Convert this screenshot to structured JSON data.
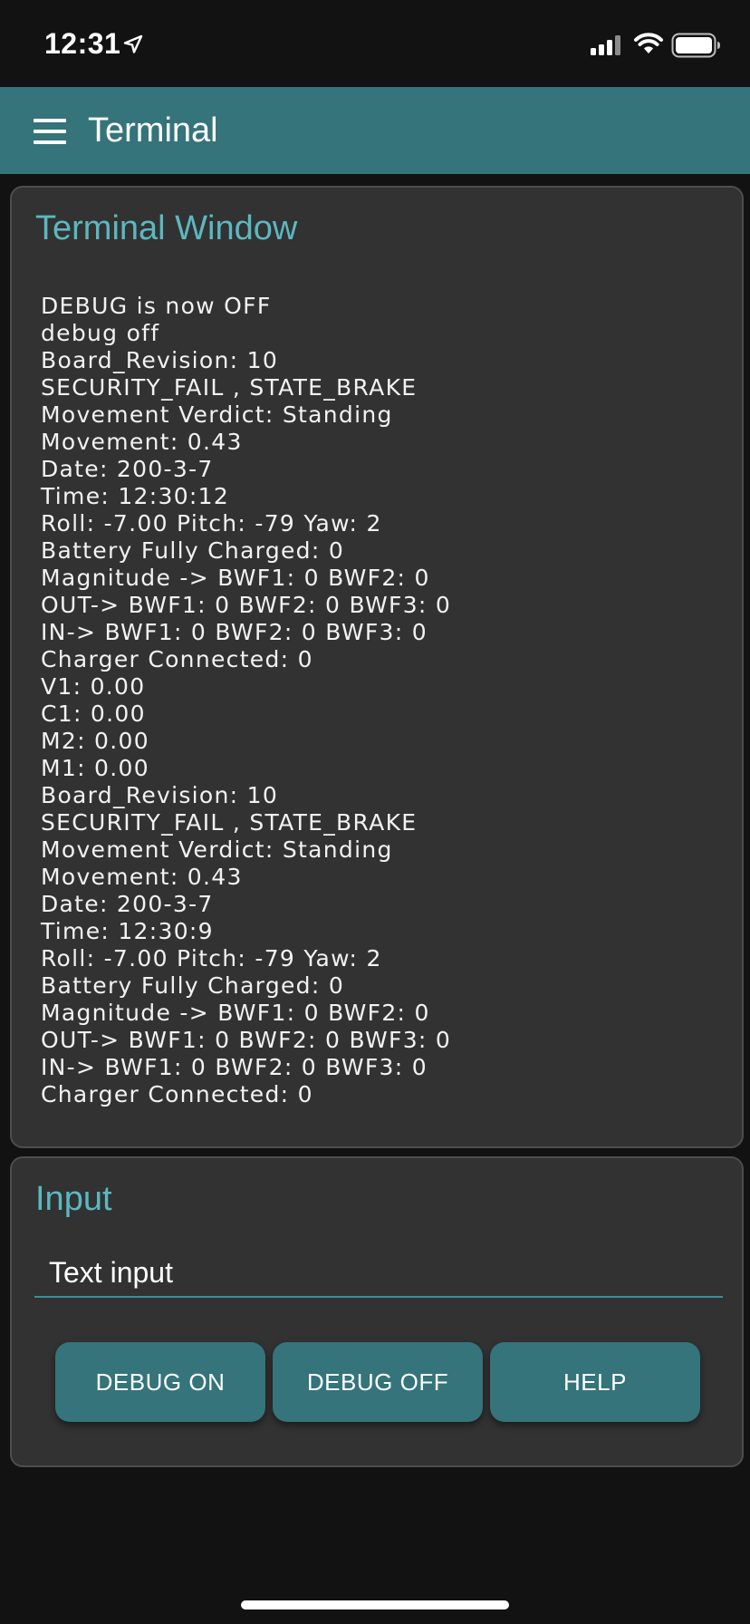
{
  "status_bar": {
    "time": "12:31",
    "icons": [
      "location-arrow-icon",
      "cellular-signal-icon",
      "wifi-icon",
      "battery-icon"
    ]
  },
  "app_bar": {
    "title": "Terminal",
    "menu_icon": "hamburger-menu-icon",
    "color": "#34747a"
  },
  "terminal": {
    "title": "Terminal Window",
    "lines": [
      "DEBUG is now OFF",
      "debug off",
      "Board_Revision: 10",
      "SECURITY_FAIL , STATE_BRAKE",
      "Movement Verdict: Standing",
      "Movement: 0.43",
      "Date: 200-3-7",
      "Time: 12:30:12",
      "Roll: -7.00 Pitch: -79 Yaw: 2",
      "Battery Fully Charged: 0",
      "Magnitude -> BWF1: 0 BWF2: 0",
      "OUT-> BWF1: 0 BWF2: 0 BWF3: 0",
      "IN-> BWF1: 0 BWF2: 0 BWF3: 0",
      "Charger Connected: 0",
      "V1: 0.00",
      "C1: 0.00",
      "M2: 0.00",
      "M1: 0.00",
      "Board_Revision: 10",
      "SECURITY_FAIL , STATE_BRAKE",
      "Movement Verdict: Standing",
      "Movement: 0.43",
      "Date: 200-3-7",
      "Time: 12:30:9",
      "Roll: -7.00 Pitch: -79 Yaw: 2",
      "Battery Fully Charged: 0",
      "Magnitude -> BWF1: 0 BWF2: 0",
      "OUT-> BWF1: 0 BWF2: 0 BWF3: 0",
      "IN-> BWF1: 0 BWF2: 0 BWF3: 0",
      "Charger Connected: 0"
    ]
  },
  "input_section": {
    "title": "Input",
    "placeholder": "Text input",
    "value": "",
    "buttons": {
      "debug_on": "DEBUG ON",
      "debug_off": "DEBUG OFF",
      "help": "HELP"
    }
  },
  "colors": {
    "accent": "#5bb8c1",
    "primary": "#34747a",
    "card_background": "#323232",
    "page_background": "#121212"
  }
}
